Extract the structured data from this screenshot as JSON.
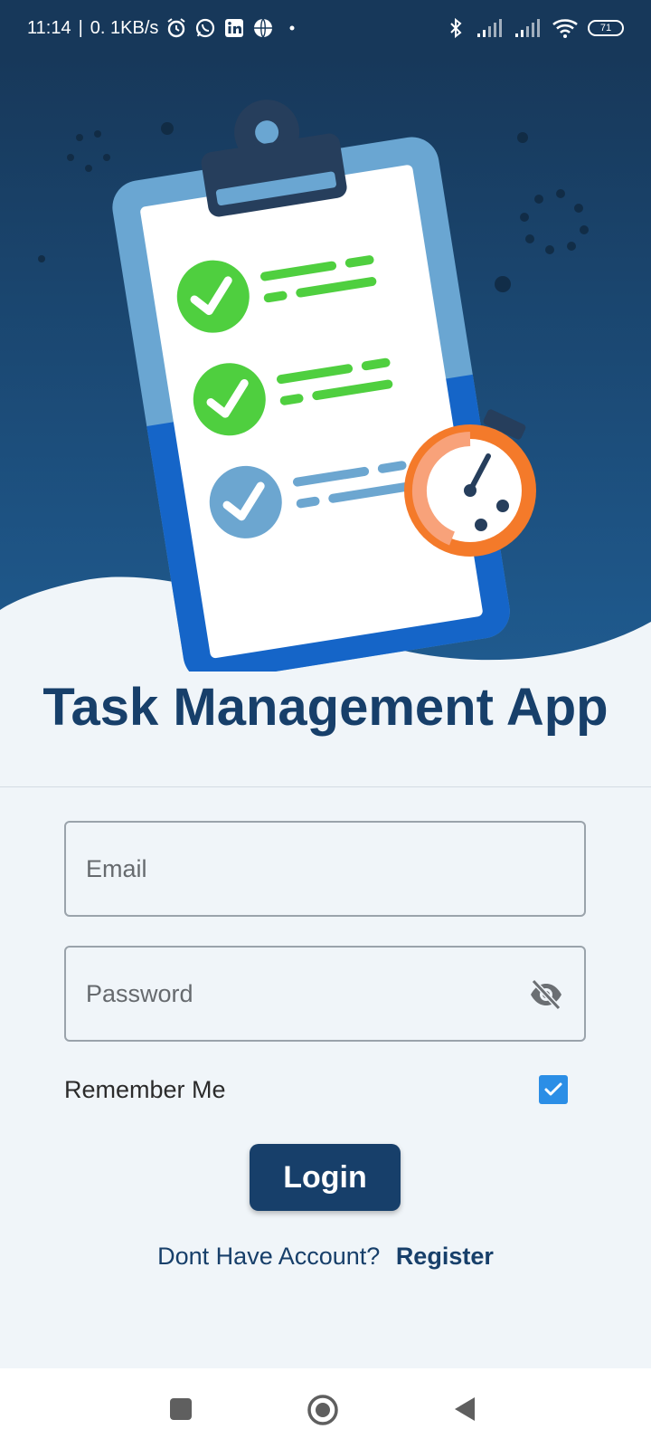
{
  "status_bar": {
    "time": "11:14",
    "separator": "|",
    "network_speed": "0. 1KB/s",
    "left_icons": [
      "alarm-icon",
      "whatsapp-icon",
      "linkedin-icon",
      "browser-icon",
      "notification-dot-icon"
    ],
    "right_icons": [
      "bluetooth-icon",
      "signal-icon",
      "signal-icon",
      "wifi-icon"
    ],
    "battery": "71"
  },
  "hero": {
    "illustration": "clipboard-checklist-stopwatch",
    "colors": {
      "bg_top": "#17385a",
      "bg_bottom": "#1f5a8e",
      "check_green": "#4fcf3f",
      "check_blue": "#6ca6d0",
      "stopwatch": "#f47a2a"
    }
  },
  "title": "Task Management App",
  "form": {
    "email_placeholder": "Email",
    "password_placeholder": "Password",
    "password_toggle_icon": "eye-off-icon",
    "remember_label": "Remember Me",
    "remember_checked": true,
    "login_label": "Login"
  },
  "register": {
    "prompt": "Dont Have Account?",
    "link": "Register"
  },
  "nav_bar": {
    "icons": [
      "recents-square-icon",
      "home-circle-icon",
      "back-triangle-icon"
    ]
  }
}
